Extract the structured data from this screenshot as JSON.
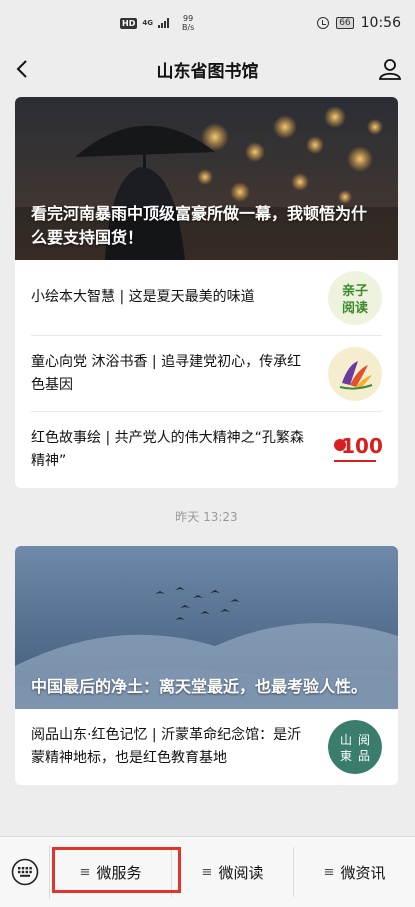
{
  "status": {
    "hd": "HD",
    "network": "4G",
    "speed_value": "99",
    "speed_unit": "B/s",
    "battery": "66",
    "time": "10:56"
  },
  "nav": {
    "title": "山东省图书馆"
  },
  "feed": {
    "group1": {
      "hero_title": "看完河南暴雨中顶级富豪所做一幕，我顿悟为什么要支持国货！",
      "items": [
        {
          "text": "小绘本大智慧 | 这是夏天最美的味道",
          "thumb_label_1": "亲子",
          "thumb_label_2": "阅读"
        },
        {
          "text": "童心向党 沐浴书香 | 追寻建党初心，传承红色基因"
        },
        {
          "text": "红色故事绘 | 共产党人的伟大精神之“孔繁森精神”",
          "thumb_label": "100"
        }
      ]
    },
    "timestamp": "昨天 13:23",
    "group2": {
      "hero_title": "中国最后的净土：离天堂最近，也最考验人性。",
      "items": [
        {
          "text": "阅品山东·红色记忆 | 沂蒙革命纪念馆：是沂蒙精神地标，也是红色教育基地",
          "thumb_label_1": "山",
          "thumb_label_2": "東",
          "thumb_label_3": "阅",
          "thumb_label_4": "品"
        }
      ]
    }
  },
  "menu": {
    "tabs": [
      {
        "icon": "≡",
        "label": "微服务"
      },
      {
        "icon": "≡",
        "label": "微阅读"
      },
      {
        "icon": "≡",
        "label": "微资讯"
      }
    ],
    "highlight_color": "#e0352b"
  }
}
